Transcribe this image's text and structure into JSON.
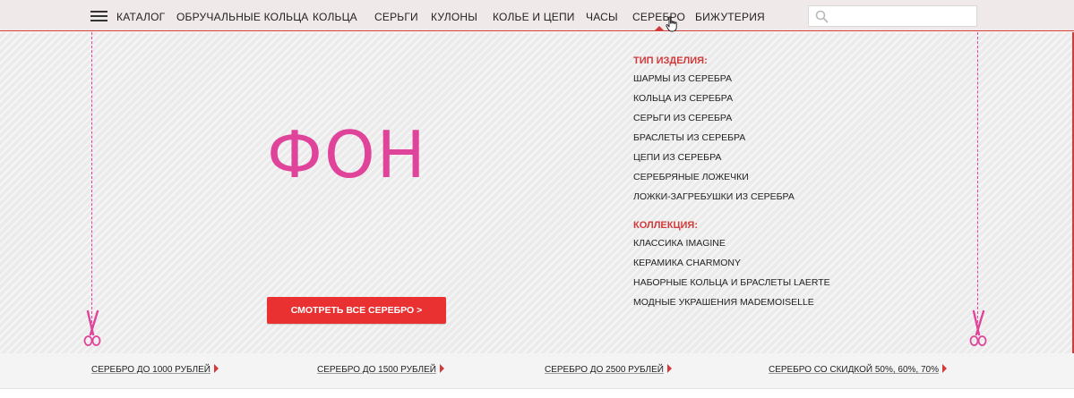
{
  "nav": {
    "catalog_label": "КАТАЛОГ",
    "items": [
      {
        "label": "ОБРУЧАЛЬНЫЕ КОЛЬЦА"
      },
      {
        "label": "КОЛЬЦА"
      },
      {
        "label": "СЕРЬГИ"
      },
      {
        "label": "КУЛОНЫ"
      },
      {
        "label": "КОЛЬЕ И ЦЕПИ"
      },
      {
        "label": "ЧАСЫ"
      },
      {
        "label": "СЕРЕБРО",
        "active": true
      },
      {
        "label": "БИЖУТЕРИЯ"
      }
    ],
    "search": {
      "value": "",
      "placeholder": ""
    }
  },
  "panel": {
    "background_label": "ФОН",
    "cta_label": "СМОТРЕТЬ ВСЕ  СЕРЕБРО >",
    "type_section": {
      "heading": "ТИП ИЗДЕЛИЯ:",
      "links": [
        "ШАРМЫ ИЗ СЕРЕБРА",
        "КОЛЬЦА ИЗ СЕРЕБРА",
        "СЕРЬГИ ИЗ СЕРЕБРА",
        "БРАСЛЕТЫ ИЗ СЕРЕБРА",
        "ЦЕПИ ИЗ СЕРЕБРА",
        "СЕРЕБРЯНЫЕ ЛОЖЕЧКИ",
        "ЛОЖКИ-ЗАГРЕБУШКИ ИЗ СЕРЕБРА"
      ]
    },
    "collection_section": {
      "heading": "КОЛЛЕКЦИЯ:",
      "links": [
        "КЛАССИКА IMAGINE",
        "КЕРАМИКА CHARMONY",
        "НАБОРНЫЕ КОЛЬЦА И БРАСЛЕТЫ LAERTE",
        "МОДНЫЕ УКРАШЕНИЯ MADEMOISELLE"
      ]
    }
  },
  "bottom_links": [
    "СЕРЕБРО  ДО 1000 РУБЛЕЙ",
    "СЕРЕБРО  ДО 1500 РУБЛЕЙ",
    "СЕРЕБРО   ДО 2500 РУБЛЕЙ",
    "СЕРЕБРО   СО СКИДКОЙ 50%, 60%, 70%"
  ],
  "colors": {
    "accent": "#d23b3b",
    "cta": "#ea3131",
    "guide_pink": "#e0449a",
    "nav_bg": "#f0e9ea"
  },
  "icons": [
    "menu-icon",
    "search-icon",
    "scissors-icon",
    "arrow-right-icon",
    "hand-cursor-icon"
  ]
}
